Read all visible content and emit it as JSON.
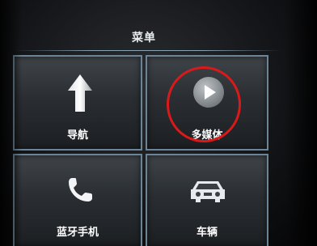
{
  "title": "菜单",
  "tiles": [
    {
      "label": "导航",
      "icon": "navigation-arrow-icon"
    },
    {
      "label": "多媒体",
      "icon": "play-icon"
    },
    {
      "label": "蓝牙手机",
      "icon": "phone-icon"
    },
    {
      "label": "车辆",
      "icon": "car-icon"
    }
  ],
  "annotation": {
    "color": "#d91a1a",
    "target": "多媒体"
  }
}
